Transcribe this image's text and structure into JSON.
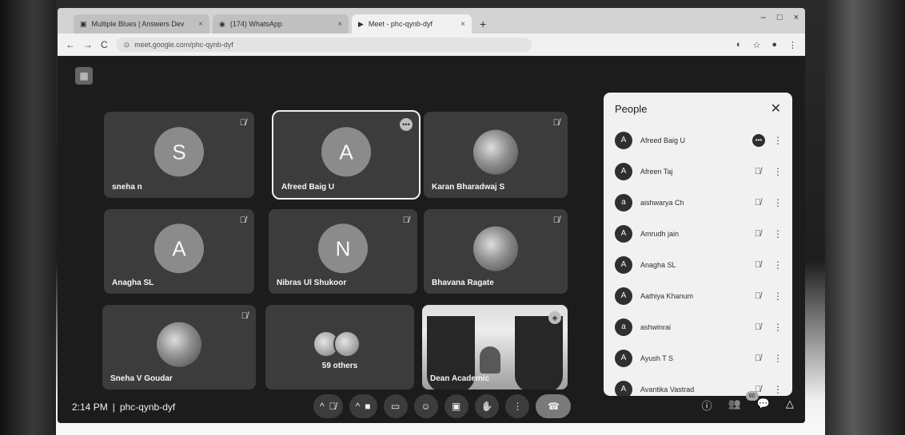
{
  "browser": {
    "tabs": [
      {
        "title": "Multiple Blues | Answers Dev",
        "active": false
      },
      {
        "title": "(174) WhatsApp",
        "active": false
      },
      {
        "title": "Meet - phc-qynb-dyf",
        "active": true
      }
    ],
    "new_tab": "+",
    "url": "meet.google.com/phc-qynb-dyf",
    "nav": {
      "back": "←",
      "forward": "→",
      "reload": "C"
    }
  },
  "tiles": [
    {
      "name": "sneha n",
      "initial": "S",
      "kind": "avatar",
      "muted": true
    },
    {
      "name": "Afreed Baig U",
      "initial": "A",
      "kind": "avatar",
      "muted": false,
      "active": true
    },
    {
      "name": "Karan Bharadwaj S",
      "initial": "",
      "kind": "photo",
      "muted": true
    },
    {
      "name": "Anagha SL",
      "initial": "A",
      "kind": "avatar",
      "muted": true
    },
    {
      "name": "Nibras Ul Shukoor",
      "initial": "N",
      "kind": "avatar",
      "muted": true
    },
    {
      "name": "Bhavana Ragate",
      "initial": "",
      "kind": "photo",
      "muted": true
    },
    {
      "name": "Sneha V Goudar",
      "initial": "",
      "kind": "photo",
      "muted": true
    },
    {
      "name": "59 others",
      "initial": "",
      "kind": "group",
      "muted": false
    },
    {
      "name": "Dean Academic",
      "initial": "",
      "kind": "video",
      "muted": false
    }
  ],
  "people_panel": {
    "title": "People",
    "participants": [
      {
        "name": "Afreed Baig U",
        "initial": "A"
      },
      {
        "name": "Afreen Taj",
        "initial": "A"
      },
      {
        "name": "aishwarya Ch",
        "initial": "a"
      },
      {
        "name": "Amrudh jain",
        "initial": "A"
      },
      {
        "name": "Anagha SL",
        "initial": "A"
      },
      {
        "name": "Aathiya Khanum",
        "initial": "A"
      },
      {
        "name": "ashwinrai",
        "initial": "a"
      },
      {
        "name": "Ayush T S",
        "initial": "A"
      },
      {
        "name": "Avantika Vastrad",
        "initial": "A"
      }
    ]
  },
  "bottom": {
    "time": "2:14 PM",
    "separator": "|",
    "meeting_code": "phc-qynb-dyf",
    "participant_count": "60"
  }
}
